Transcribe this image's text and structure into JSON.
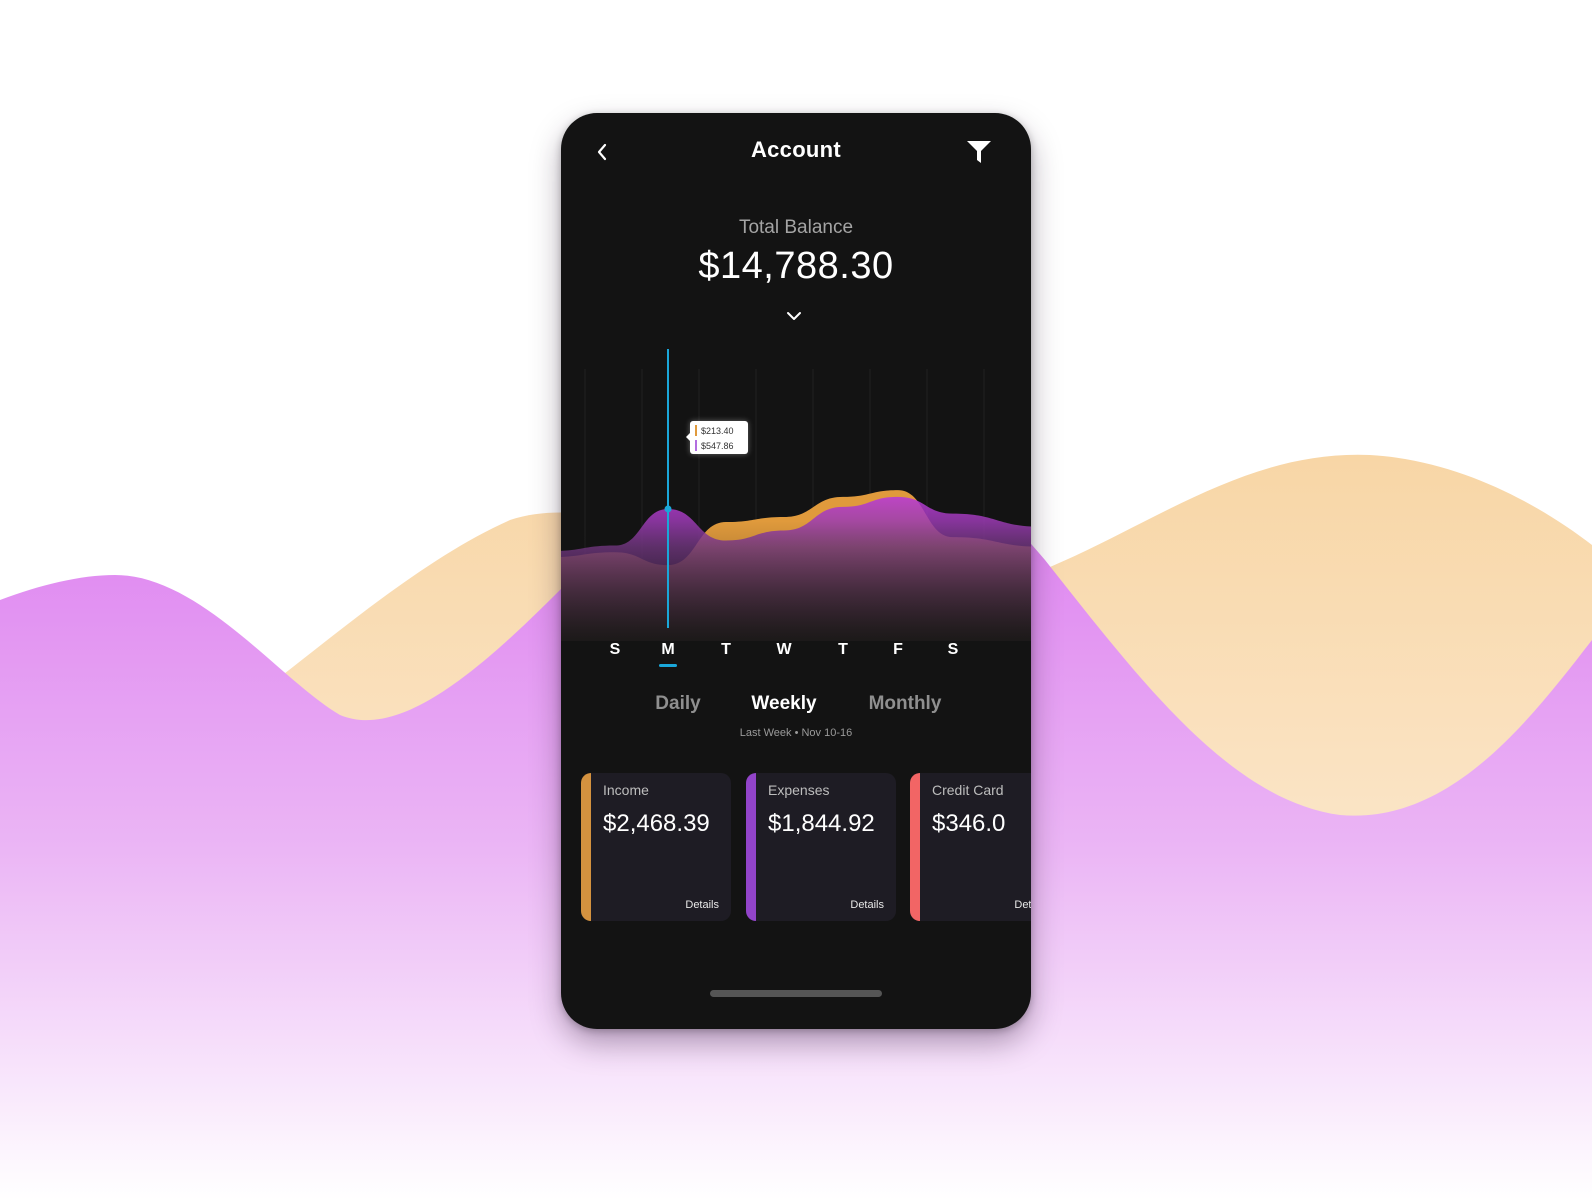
{
  "colors": {
    "income": "#e09a3c",
    "expenses": "#9b39d0",
    "credit_card": "#f26060",
    "cursor": "#1aa7d9",
    "bg_wave_orange": "#f8d9ad",
    "bg_wave_purple": "#dc7ef0"
  },
  "header": {
    "back_icon": "chevron-left-icon",
    "title": "Account",
    "filter_icon": "filter-funnel-icon"
  },
  "balance": {
    "label": "Total Balance",
    "value": "$14,788.30",
    "expand_icon": "chevron-down-icon"
  },
  "chart_data": {
    "type": "area",
    "title": "",
    "xlabel": "",
    "ylabel": "",
    "categories": [
      "S",
      "M",
      "T",
      "W",
      "T",
      "F",
      "S"
    ],
    "grid": "vertical",
    "series": [
      {
        "name": "Income",
        "color": "#e09a3c",
        "values": [
          290,
          213.4,
          470,
          500,
          620,
          660,
          380
        ]
      },
      {
        "name": "Expenses",
        "color": "#9b39d0",
        "values": [
          330,
          547.86,
          360,
          420,
          560,
          620,
          520
        ]
      }
    ],
    "ylim": [
      0,
      1000
    ],
    "selected_index": 1,
    "tooltip": {
      "income": "$213.40",
      "expenses": "$547.86"
    }
  },
  "days": [
    {
      "label": "S",
      "active": false
    },
    {
      "label": "M",
      "active": true
    },
    {
      "label": "T",
      "active": false
    },
    {
      "label": "W",
      "active": false
    },
    {
      "label": "T",
      "active": false
    },
    {
      "label": "F",
      "active": false
    },
    {
      "label": "S",
      "active": false
    }
  ],
  "periods": [
    {
      "label": "Daily",
      "active": false
    },
    {
      "label": "Weekly",
      "active": true
    },
    {
      "label": "Monthly",
      "active": false
    }
  ],
  "range_label": "Last Week • Nov 10-16",
  "cards": [
    {
      "label": "Income",
      "amount": "$2,468.39",
      "details": "Details",
      "color": "#d4923f"
    },
    {
      "label": "Expenses",
      "amount": "$1,844.92",
      "details": "Details",
      "color": "#9244c9"
    },
    {
      "label": "Credit Card",
      "amount": "$346.0",
      "details": "Details",
      "color": "#f26565"
    }
  ]
}
